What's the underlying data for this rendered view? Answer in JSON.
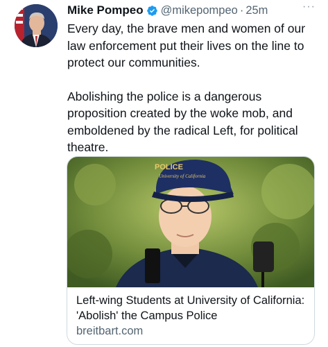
{
  "tweet": {
    "author_name": "Mike Pompeo",
    "handle": "@mikepompeo",
    "separator": "·",
    "time": "25m",
    "more": "···",
    "paragraphs": [
      "Every day, the brave men and women of our law enforcement put their lives on the line to protect our communities.",
      "Abolishing the police is a dangerous proposition created by the woke mob, and emboldened by the radical Left, for political theatre."
    ]
  },
  "card": {
    "title": "Left-wing Students at University of California: 'Abolish' the Campus Police",
    "domain": "breitbart.com",
    "image_cap_text": "POLICE",
    "image_cap_subtext": "University of California"
  },
  "icons": {
    "verified": "verified-badge-icon",
    "more": "more-options-icon"
  },
  "colors": {
    "verified_blue": "#1d9bf0",
    "secondary_text": "#536471",
    "card_border": "#cfd9de"
  }
}
